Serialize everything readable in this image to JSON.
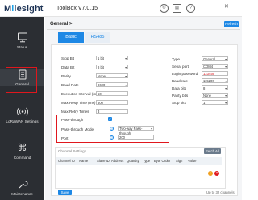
{
  "app": {
    "logo": "Milesight",
    "title": "ToolBox V7.0.15",
    "icons": [
      "copyright-icon",
      "file-icon",
      "question-icon",
      "minimize-icon",
      "close-icon"
    ],
    "minimize_label": "—",
    "close_label": "✕"
  },
  "sidebar": {
    "items": [
      {
        "label": "Status",
        "icon": "monitor-icon"
      },
      {
        "label": "General",
        "icon": "sliders-icon",
        "active": true
      },
      {
        "label": "LoRaWAN Settings",
        "icon": "radio-waves-icon"
      },
      {
        "label": "Command",
        "icon": "command-key-icon"
      },
      {
        "label": "Maintenance",
        "icon": "wrench-icon"
      }
    ]
  },
  "page": {
    "title": "General >",
    "refresh_label": "Refresh"
  },
  "tabs": [
    {
      "label": "Basic",
      "active": true
    },
    {
      "label": "RS485",
      "active": false
    }
  ],
  "left_form": {
    "stop_bit": {
      "label": "Stop Bit",
      "value": "1 bit"
    },
    "data_bit": {
      "label": "Data Bit",
      "value": "8 bit"
    },
    "parity": {
      "label": "Parity",
      "value": "None"
    },
    "baud_rate": {
      "label": "Baud Rate",
      "value": "9600"
    },
    "exec_interval": {
      "label": "Execution Interval (ms)",
      "value": "50"
    },
    "max_resp_time": {
      "label": "Max Resp Time (ms)",
      "value": "500"
    },
    "max_retry": {
      "label": "Max Retry Times",
      "value": "3"
    }
  },
  "right_form": {
    "type": {
      "label": "Type",
      "value": "General"
    },
    "serial_port": {
      "label": "Serial port",
      "value": "COM4"
    },
    "login_password": {
      "label": "Login password",
      "value": "123456"
    },
    "baud_rate": {
      "label": "Baud rate",
      "value": "115200"
    },
    "data_bits": {
      "label": "Data bits",
      "value": "8"
    },
    "parity": {
      "label": "Parity bits",
      "value": "None"
    },
    "stop_bits": {
      "label": "Stop bits",
      "value": "1"
    }
  },
  "passthrough": {
    "enable_label": "Pass-through",
    "enabled": true,
    "mode_label": "Pass-through Mode",
    "mode_value": "Two-way Pass-through",
    "port_label": "Port",
    "port_value": "200"
  },
  "channel": {
    "title": "Channel Settings",
    "fetch_all_label": "Fetch All",
    "columns": [
      "Channel ID",
      "Name",
      "Slave ID",
      "Address",
      "Quantity",
      "Type",
      "Byte Order",
      "Sign",
      "Value"
    ],
    "add_label": "+",
    "remove_label": "×"
  },
  "footer": {
    "save_label": "Save",
    "limit_text": "Up to 32 channels"
  },
  "colors": {
    "accent": "#1e88e5",
    "sidebar": "#2b2e33",
    "highlight": "#e0171d"
  }
}
